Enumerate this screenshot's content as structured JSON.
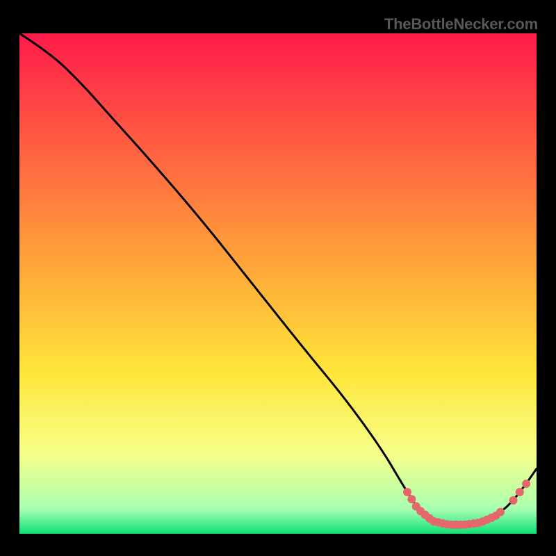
{
  "attribution": "TheBottleNecker.com",
  "chart_data": {
    "type": "line",
    "title": "",
    "xlabel": "",
    "ylabel": "",
    "xlim": [
      0,
      100
    ],
    "ylim": [
      0,
      100
    ],
    "gradient_stops": [
      {
        "offset": 0,
        "color": "#ff1b4a"
      },
      {
        "offset": 0.45,
        "color": "#ffa23a"
      },
      {
        "offset": 0.68,
        "color": "#ffe63a"
      },
      {
        "offset": 0.84,
        "color": "#f6ff8a"
      },
      {
        "offset": 0.95,
        "color": "#aaffb0"
      },
      {
        "offset": 1.0,
        "color": "#10e07a"
      }
    ],
    "curve": [
      {
        "x": 0,
        "y": 100
      },
      {
        "x": 6,
        "y": 96
      },
      {
        "x": 12,
        "y": 90
      },
      {
        "x": 18,
        "y": 83
      },
      {
        "x": 25,
        "y": 75
      },
      {
        "x": 35,
        "y": 63
      },
      {
        "x": 45,
        "y": 50
      },
      {
        "x": 55,
        "y": 37
      },
      {
        "x": 63,
        "y": 27
      },
      {
        "x": 70,
        "y": 17
      },
      {
        "x": 74,
        "y": 10
      },
      {
        "x": 77,
        "y": 5
      },
      {
        "x": 80,
        "y": 2.5
      },
      {
        "x": 83,
        "y": 1.8
      },
      {
        "x": 86,
        "y": 1.8
      },
      {
        "x": 89,
        "y": 2.2
      },
      {
        "x": 92,
        "y": 3.5
      },
      {
        "x": 95,
        "y": 6
      },
      {
        "x": 98,
        "y": 10
      },
      {
        "x": 100,
        "y": 13
      }
    ],
    "marker_cluster_left": {
      "x_start": 75,
      "x_end": 93,
      "count": 22
    },
    "marker_cluster_right": {
      "x_start": 95.5,
      "x_end": 98,
      "count": 3
    },
    "marker_color": "#e4676c",
    "marker_radius": 6
  }
}
